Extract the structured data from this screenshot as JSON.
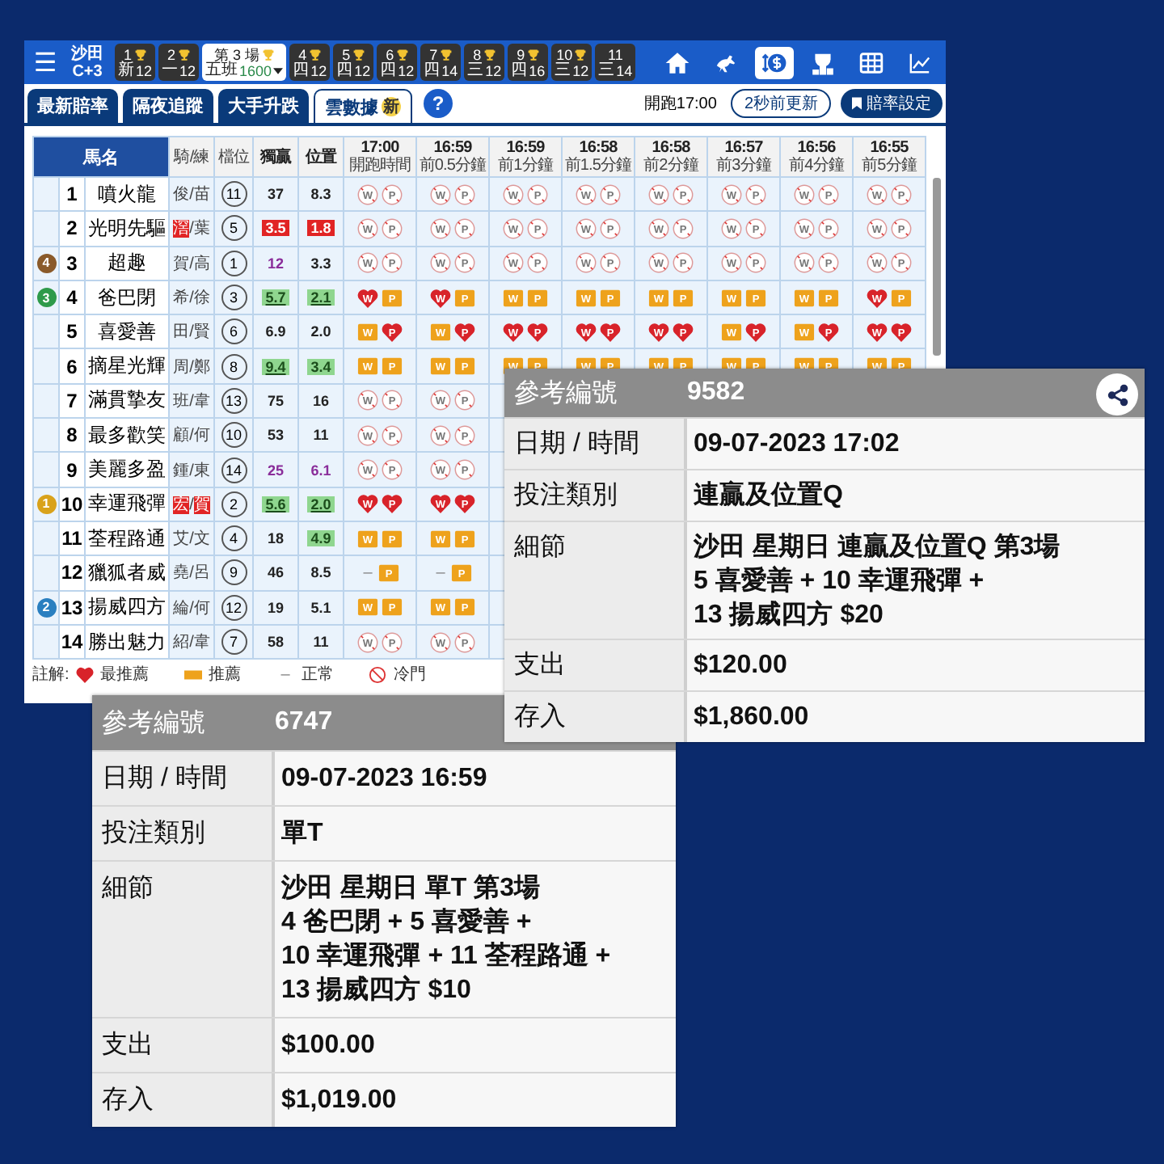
{
  "topbar": {
    "menu": "☰",
    "venue": "沙田",
    "track": "C+3",
    "races": [
      {
        "number": "1",
        "class": "新",
        "count": "12",
        "trophy": true,
        "selected": false
      },
      {
        "number": "2",
        "class": "一",
        "count": "12",
        "trophy": true,
        "selected": false
      },
      {
        "number": "第 3 場",
        "class": "五班",
        "count": "1600",
        "trophy": true,
        "selected": true
      },
      {
        "number": "4",
        "class": "四",
        "count": "12",
        "trophy": true,
        "selected": false
      },
      {
        "number": "5",
        "class": "四",
        "count": "12",
        "trophy": true,
        "selected": false
      },
      {
        "number": "6",
        "class": "四",
        "count": "12",
        "trophy": true,
        "selected": false
      },
      {
        "number": "7",
        "class": "四",
        "count": "14",
        "trophy": true,
        "selected": false
      },
      {
        "number": "8",
        "class": "三",
        "count": "12",
        "trophy": true,
        "selected": false
      },
      {
        "number": "9",
        "class": "四",
        "count": "16",
        "trophy": true,
        "selected": false
      },
      {
        "number": "10",
        "class": "三",
        "count": "12",
        "trophy": true,
        "selected": false
      },
      {
        "number": "11",
        "class": "三",
        "count": "14",
        "trophy": false,
        "selected": false
      }
    ],
    "tools": [
      {
        "kind": "home",
        "selected": false
      },
      {
        "kind": "horse",
        "selected": false
      },
      {
        "kind": "money",
        "selected": true
      },
      {
        "kind": "podium",
        "selected": false
      },
      {
        "kind": "grid",
        "selected": false
      },
      {
        "kind": "chart",
        "selected": false
      }
    ]
  },
  "tabs": [
    {
      "label": "最新賠率",
      "selected": false
    },
    {
      "label": "隔夜追蹤",
      "selected": false
    },
    {
      "label": "大手升跌",
      "selected": false
    },
    {
      "label": "雲數據",
      "badge": "新",
      "selected": true
    }
  ],
  "help": "?",
  "start_time": "開跑17:00",
  "refresh": "2秒前更新",
  "odds_settings": "賠率設定",
  "table": {
    "name_header": "馬名",
    "columns": [
      "騎/練",
      "檔位",
      "獨贏",
      "位置"
    ],
    "times": [
      {
        "time": "17:00",
        "sub": "開跑時間"
      },
      {
        "time": "16:59",
        "sub": "前0.5分鐘"
      },
      {
        "time": "16:59",
        "sub": "前1分鐘"
      },
      {
        "time": "16:58",
        "sub": "前1.5分鐘"
      },
      {
        "time": "16:58",
        "sub": "前2分鐘"
      },
      {
        "time": "16:57",
        "sub": "前3分鐘"
      },
      {
        "time": "16:56",
        "sub": "前4分鐘"
      },
      {
        "time": "16:55",
        "sub": "前5分鐘"
      }
    ],
    "jockey_separator": "/",
    "rows": [
      {
        "no": "1",
        "name": "噴火龍",
        "jockey": "俊",
        "trainer": "苗",
        "jockey_hot": false,
        "trainer_hot": false,
        "draw": "11",
        "win": {
          "value": "37",
          "kind": "plain"
        },
        "place": {
          "value": "8.3",
          "kind": "plain"
        },
        "signals": [
          [
            {
              "text": "W",
              "kind": "cold"
            },
            {
              "text": "P",
              "kind": "cold"
            }
          ],
          [
            {
              "text": "W",
              "kind": "cold"
            },
            {
              "text": "P",
              "kind": "cold"
            }
          ],
          [
            {
              "text": "W",
              "kind": "cold"
            },
            {
              "text": "P",
              "kind": "cold"
            }
          ],
          [
            {
              "text": "W",
              "kind": "cold"
            },
            {
              "text": "P",
              "kind": "cold"
            }
          ],
          [
            {
              "text": "W",
              "kind": "cold"
            },
            {
              "text": "P",
              "kind": "cold"
            }
          ],
          [
            {
              "text": "W",
              "kind": "cold"
            },
            {
              "text": "P",
              "kind": "cold"
            }
          ],
          [
            {
              "text": "W",
              "kind": "cold"
            },
            {
              "text": "P",
              "kind": "cold"
            }
          ],
          [
            {
              "text": "W",
              "kind": "cold"
            },
            {
              "text": "P",
              "kind": "cold"
            }
          ]
        ]
      },
      {
        "no": "2",
        "name": "光明先驅",
        "jockey": "滘",
        "trainer": "葉",
        "jockey_hot": true,
        "trainer_hot": false,
        "draw": "5",
        "win": {
          "value": "3.5",
          "kind": "red-fill"
        },
        "place": {
          "value": "1.8",
          "kind": "red-fill"
        },
        "signals": [
          [
            {
              "text": "W",
              "kind": "cold"
            },
            {
              "text": "P",
              "kind": "cold"
            }
          ],
          [
            {
              "text": "W",
              "kind": "cold"
            },
            {
              "text": "P",
              "kind": "cold"
            }
          ],
          [
            {
              "text": "W",
              "kind": "cold"
            },
            {
              "text": "P",
              "kind": "cold"
            }
          ],
          [
            {
              "text": "W",
              "kind": "cold"
            },
            {
              "text": "P",
              "kind": "cold"
            }
          ],
          [
            {
              "text": "W",
              "kind": "cold"
            },
            {
              "text": "P",
              "kind": "cold"
            }
          ],
          [
            {
              "text": "W",
              "kind": "cold"
            },
            {
              "text": "P",
              "kind": "cold"
            }
          ],
          [
            {
              "text": "W",
              "kind": "cold"
            },
            {
              "text": "P",
              "kind": "cold"
            }
          ],
          [
            {
              "text": "W",
              "kind": "cold"
            },
            {
              "text": "P",
              "kind": "cold"
            }
          ]
        ]
      },
      {
        "no": "3",
        "name": "超趣",
        "medal": {
          "label": "4",
          "color": "#8a5a2a"
        },
        "jockey": "賀",
        "trainer": "高",
        "jockey_hot": false,
        "trainer_hot": false,
        "draw": "1",
        "win": {
          "value": "12",
          "kind": "purple-text"
        },
        "place": {
          "value": "3.3",
          "kind": "plain"
        },
        "signals": [
          [
            {
              "text": "W",
              "kind": "cold"
            },
            {
              "text": "P",
              "kind": "cold"
            }
          ],
          [
            {
              "text": "W",
              "kind": "cold"
            },
            {
              "text": "P",
              "kind": "cold"
            }
          ],
          [
            {
              "text": "W",
              "kind": "cold"
            },
            {
              "text": "P",
              "kind": "cold"
            }
          ],
          [
            {
              "text": "W",
              "kind": "cold"
            },
            {
              "text": "P",
              "kind": "cold"
            }
          ],
          [
            {
              "text": "W",
              "kind": "cold"
            },
            {
              "text": "P",
              "kind": "cold"
            }
          ],
          [
            {
              "text": "W",
              "kind": "cold"
            },
            {
              "text": "P",
              "kind": "cold"
            }
          ],
          [
            {
              "text": "W",
              "kind": "cold"
            },
            {
              "text": "P",
              "kind": "cold"
            }
          ],
          [
            {
              "text": "W",
              "kind": "cold"
            },
            {
              "text": "P",
              "kind": "cold"
            }
          ]
        ]
      },
      {
        "no": "4",
        "name": "爸巴閉",
        "medal": {
          "label": "3",
          "color": "#2e9a4a"
        },
        "jockey": "希",
        "trainer": "徐",
        "jockey_hot": false,
        "trainer_hot": false,
        "draw": "3",
        "win": {
          "value": "5.7",
          "kind": "green-fill-underlined"
        },
        "place": {
          "value": "2.1",
          "kind": "green-fill-underlined"
        },
        "signals": [
          [
            {
              "text": "W",
              "kind": "heart"
            },
            {
              "text": "P",
              "kind": "square"
            }
          ],
          [
            {
              "text": "W",
              "kind": "heart"
            },
            {
              "text": "P",
              "kind": "square"
            }
          ],
          [
            {
              "text": "W",
              "kind": "square"
            },
            {
              "text": "P",
              "kind": "square"
            }
          ],
          [
            {
              "text": "W",
              "kind": "square"
            },
            {
              "text": "P",
              "kind": "square"
            }
          ],
          [
            {
              "text": "W",
              "kind": "square"
            },
            {
              "text": "P",
              "kind": "square"
            }
          ],
          [
            {
              "text": "W",
              "kind": "square"
            },
            {
              "text": "P",
              "kind": "square"
            }
          ],
          [
            {
              "text": "W",
              "kind": "square"
            },
            {
              "text": "P",
              "kind": "square"
            }
          ],
          [
            {
              "text": "W",
              "kind": "heart"
            },
            {
              "text": "P",
              "kind": "square"
            }
          ]
        ]
      },
      {
        "no": "5",
        "name": "喜愛善",
        "jockey": "田",
        "trainer": "賢",
        "jockey_hot": false,
        "trainer_hot": false,
        "draw": "6",
        "win": {
          "value": "6.9",
          "kind": "plain"
        },
        "place": {
          "value": "2.0",
          "kind": "plain"
        },
        "signals": [
          [
            {
              "text": "W",
              "kind": "square"
            },
            {
              "text": "P",
              "kind": "heart"
            }
          ],
          [
            {
              "text": "W",
              "kind": "square"
            },
            {
              "text": "P",
              "kind": "heart"
            }
          ],
          [
            {
              "text": "W",
              "kind": "heart"
            },
            {
              "text": "P",
              "kind": "heart"
            }
          ],
          [
            {
              "text": "W",
              "kind": "heart"
            },
            {
              "text": "P",
              "kind": "heart"
            }
          ],
          [
            {
              "text": "W",
              "kind": "heart"
            },
            {
              "text": "P",
              "kind": "heart"
            }
          ],
          [
            {
              "text": "W",
              "kind": "square"
            },
            {
              "text": "P",
              "kind": "heart"
            }
          ],
          [
            {
              "text": "W",
              "kind": "square"
            },
            {
              "text": "P",
              "kind": "heart"
            }
          ],
          [
            {
              "text": "W",
              "kind": "heart"
            },
            {
              "text": "P",
              "kind": "heart"
            }
          ]
        ]
      },
      {
        "no": "6",
        "name": "摘星光輝",
        "jockey": "周",
        "trainer": "鄭",
        "jockey_hot": false,
        "trainer_hot": false,
        "draw": "8",
        "win": {
          "value": "9.4",
          "kind": "green-fill-underlined"
        },
        "place": {
          "value": "3.4",
          "kind": "green-fill"
        },
        "signals": [
          [
            {
              "text": "W",
              "kind": "square"
            },
            {
              "text": "P",
              "kind": "square"
            }
          ],
          [
            {
              "text": "W",
              "kind": "square"
            },
            {
              "text": "P",
              "kind": "square"
            }
          ],
          [
            {
              "text": "W",
              "kind": "square"
            },
            {
              "text": "P",
              "kind": "square"
            }
          ],
          [
            {
              "text": "W",
              "kind": "square"
            },
            {
              "text": "P",
              "kind": "square"
            }
          ],
          [
            {
              "text": "W",
              "kind": "square"
            },
            {
              "text": "P",
              "kind": "square"
            }
          ],
          [
            {
              "text": "W",
              "kind": "square"
            },
            {
              "text": "P",
              "kind": "square"
            }
          ],
          [
            {
              "text": "W",
              "kind": "square"
            },
            {
              "text": "P",
              "kind": "square"
            }
          ],
          [
            {
              "text": "W",
              "kind": "square"
            },
            {
              "text": "P",
              "kind": "square"
            }
          ]
        ]
      },
      {
        "no": "7",
        "name": "滿貫摯友",
        "jockey": "班",
        "trainer": "韋",
        "jockey_hot": false,
        "trainer_hot": false,
        "draw": "13",
        "win": {
          "value": "75",
          "kind": "plain"
        },
        "place": {
          "value": "16",
          "kind": "plain"
        },
        "signals": [
          [
            {
              "text": "W",
              "kind": "cold"
            },
            {
              "text": "P",
              "kind": "cold"
            }
          ],
          [
            {
              "text": "W",
              "kind": "cold"
            },
            {
              "text": "P",
              "kind": "cold"
            }
          ]
        ]
      },
      {
        "no": "8",
        "name": "最多歡笑",
        "jockey": "顧",
        "trainer": "何",
        "jockey_hot": false,
        "trainer_hot": false,
        "draw": "10",
        "win": {
          "value": "53",
          "kind": "plain"
        },
        "place": {
          "value": "11",
          "kind": "plain"
        },
        "signals": [
          [
            {
              "text": "W",
              "kind": "cold"
            },
            {
              "text": "P",
              "kind": "cold"
            }
          ],
          [
            {
              "text": "W",
              "kind": "cold"
            },
            {
              "text": "P",
              "kind": "cold"
            }
          ]
        ]
      },
      {
        "no": "9",
        "name": "美麗多盈",
        "jockey": "鍾",
        "trainer": "東",
        "jockey_hot": false,
        "trainer_hot": false,
        "draw": "14",
        "win": {
          "value": "25",
          "kind": "purple-text"
        },
        "place": {
          "value": "6.1",
          "kind": "purple-text"
        },
        "signals": [
          [
            {
              "text": "W",
              "kind": "cold"
            },
            {
              "text": "P",
              "kind": "cold"
            }
          ],
          [
            {
              "text": "W",
              "kind": "cold"
            },
            {
              "text": "P",
              "kind": "cold"
            }
          ]
        ]
      },
      {
        "no": "10",
        "name": "幸運飛彈",
        "medal": {
          "label": "1",
          "color": "#d9a21b"
        },
        "jockey": "宏",
        "trainer": "賀",
        "jockey_hot": true,
        "trainer_hot": true,
        "draw": "2",
        "win": {
          "value": "5.6",
          "kind": "green-fill-underlined"
        },
        "place": {
          "value": "2.0",
          "kind": "green-fill-underlined"
        },
        "signals": [
          [
            {
              "text": "W",
              "kind": "heart"
            },
            {
              "text": "P",
              "kind": "heart"
            }
          ],
          [
            {
              "text": "W",
              "kind": "heart"
            },
            {
              "text": "P",
              "kind": "heart"
            }
          ]
        ]
      },
      {
        "no": "11",
        "name": "荃程路通",
        "jockey": "艾",
        "trainer": "文",
        "jockey_hot": false,
        "trainer_hot": false,
        "draw": "4",
        "win": {
          "value": "18",
          "kind": "plain"
        },
        "place": {
          "value": "4.9",
          "kind": "green-fill"
        },
        "signals": [
          [
            {
              "text": "W",
              "kind": "square"
            },
            {
              "text": "P",
              "kind": "square"
            }
          ],
          [
            {
              "text": "W",
              "kind": "square"
            },
            {
              "text": "P",
              "kind": "square"
            }
          ]
        ]
      },
      {
        "no": "12",
        "name": "獵狐者威",
        "jockey": "堯",
        "trainer": "呂",
        "jockey_hot": false,
        "trainer_hot": false,
        "draw": "9",
        "win": {
          "value": "46",
          "kind": "plain"
        },
        "place": {
          "value": "8.5",
          "kind": "plain"
        },
        "signals": [
          [
            {
              "text": "–",
              "kind": "dash"
            },
            {
              "text": "P",
              "kind": "square"
            }
          ],
          [
            {
              "text": "–",
              "kind": "dash"
            },
            {
              "text": "P",
              "kind": "square"
            }
          ]
        ]
      },
      {
        "no": "13",
        "name": "揚威四方",
        "medal": {
          "label": "2",
          "color": "#2a7fc0"
        },
        "jockey": "綸",
        "trainer": "何",
        "jockey_hot": false,
        "trainer_hot": false,
        "draw": "12",
        "win": {
          "value": "19",
          "kind": "plain"
        },
        "place": {
          "value": "5.1",
          "kind": "plain"
        },
        "signals": [
          [
            {
              "text": "W",
              "kind": "square"
            },
            {
              "text": "P",
              "kind": "square"
            }
          ],
          [
            {
              "text": "W",
              "kind": "square"
            },
            {
              "text": "P",
              "kind": "square"
            }
          ]
        ]
      },
      {
        "no": "14",
        "name": "勝出魅力",
        "jockey": "紹",
        "trainer": "韋",
        "jockey_hot": false,
        "trainer_hot": false,
        "draw": "7",
        "win": {
          "value": "58",
          "kind": "plain"
        },
        "place": {
          "value": "11",
          "kind": "plain"
        },
        "signals": [
          [
            {
              "text": "W",
              "kind": "cold"
            },
            {
              "text": "P",
              "kind": "cold"
            }
          ],
          [
            {
              "text": "W",
              "kind": "cold"
            },
            {
              "text": "P",
              "kind": "cold"
            }
          ]
        ]
      }
    ]
  },
  "legend": {
    "title": "註解:",
    "items": [
      {
        "kind": "heart",
        "label": "最推薦"
      },
      {
        "kind": "square",
        "label": "推薦"
      },
      {
        "kind": "dash",
        "symbol": "–",
        "label": "正常"
      },
      {
        "kind": "cold",
        "label": "冷門"
      }
    ]
  },
  "slips": [
    {
      "ref_label": "參考編號",
      "ref": "9582",
      "share": true,
      "rows": [
        {
          "label": "日期 / 時間",
          "lines": [
            "09-07-2023 17:02"
          ]
        },
        {
          "label": "投注類別",
          "lines": [
            "連贏及位置Q"
          ]
        },
        {
          "label": "細節",
          "lines": [
            "沙田 星期日 連贏及位置Q 第3場",
            "5 喜愛善 + 10 幸運飛彈 +",
            "13 揚威四方 $20"
          ]
        },
        {
          "label": "支出",
          "lines": [
            "$120.00"
          ]
        },
        {
          "label": "存入",
          "lines": [
            "$1,860.00"
          ]
        }
      ]
    },
    {
      "ref_label": "參考編號",
      "ref": "6747",
      "rows": [
        {
          "label": "日期 / 時間",
          "lines": [
            "09-07-2023 16:59"
          ]
        },
        {
          "label": "投注類別",
          "lines": [
            "單T"
          ]
        },
        {
          "label": "細節",
          "lines": [
            "沙田 星期日 單T 第3場",
            "4 爸巴閉 + 5 喜愛善 +",
            "10 幸運飛彈 + 11 荃程路通 +",
            "13 揚威四方 $10"
          ]
        },
        {
          "label": "支出",
          "lines": [
            "$100.00"
          ]
        },
        {
          "label": "存入",
          "lines": [
            "$1,019.00"
          ]
        }
      ]
    }
  ]
}
